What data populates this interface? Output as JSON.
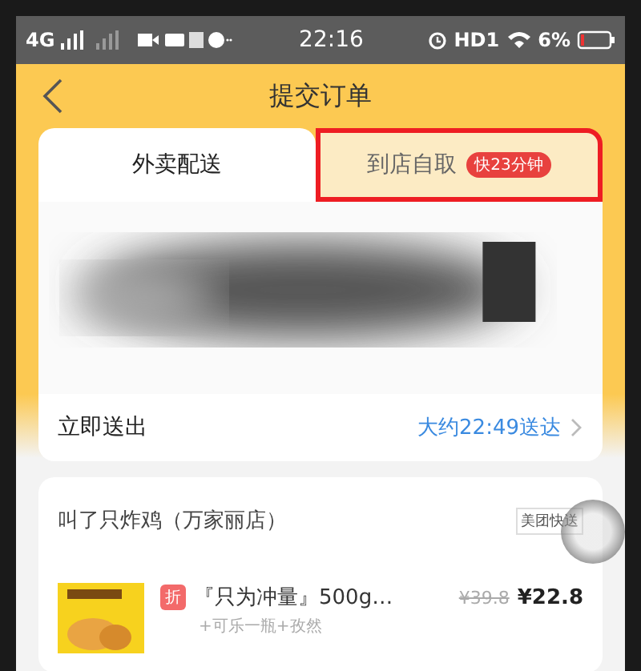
{
  "status_bar": {
    "network": "4G",
    "time": "22:16",
    "hd": "HD1",
    "battery": "6%"
  },
  "header": {
    "title": "提交订单"
  },
  "tabs": [
    {
      "label": "外卖配送",
      "selected": true
    },
    {
      "label": "到店自取",
      "badge": "快23分钟",
      "selected": false,
      "highlighted": true
    }
  ],
  "delivery": {
    "label": "立即送出",
    "eta": "大约22:49送达"
  },
  "store": {
    "name": "叫了只炸鸡（万家丽店）",
    "tag": "美团快送"
  },
  "items": [
    {
      "discount_tag": "折",
      "name": "『只为冲量』500g…",
      "options": "+可乐一瓶+孜然",
      "original_price": "¥39.8",
      "price": "¥22.8"
    }
  ]
}
